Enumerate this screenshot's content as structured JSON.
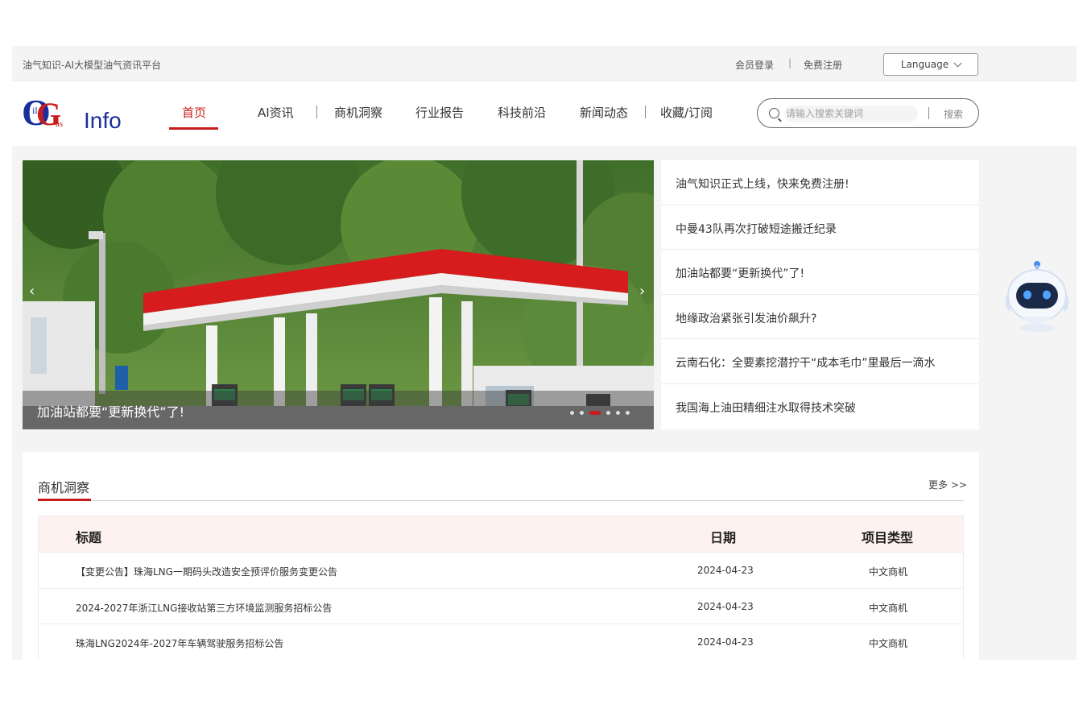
{
  "topbar": {
    "slogan": "油气知识-AI大模型油气资讯平台",
    "login": "会员登录",
    "separator": "|",
    "register": "免费注册",
    "language": "Language"
  },
  "logo": {
    "text_o": "O",
    "text_i": "il",
    "text_g": "G",
    "text_as": "as",
    "text_info": "Info"
  },
  "nav": {
    "items": [
      "首页",
      "AI资讯",
      "商机洞察",
      "行业报告",
      "科技前沿",
      "新闻动态",
      "收藏/订阅"
    ],
    "active": "首页"
  },
  "search": {
    "placeholder": "请输入搜索关键词",
    "button": "搜索"
  },
  "banner": {
    "caption": "加油站都要“更新换代”了!",
    "prev": "‹",
    "next": "›",
    "slide_count": 6,
    "active_slide": 3
  },
  "news": [
    "油气知识正式上线，快来免费注册!",
    "中曼43队再次打破短途搬迁纪录",
    "加油站都要“更新换代”了!",
    "地缘政治紧张引发油价飙升?",
    "云南石化：全要素挖潜拧干“成本毛巾”里最后一滴水",
    "我国海上油田精细注水取得技术突破"
  ],
  "opportunities": {
    "title": "商机洞察",
    "more": "更多 >>",
    "columns": [
      "标题",
      "日期",
      "项目类型"
    ],
    "rows": [
      [
        "【变更公告】珠海LNG一期码头改造安全预评价服务变更公告",
        "2024-04-23",
        "中文商机"
      ],
      [
        "2024-2027年浙江LNG接收站第三方环境监测服务招标公告",
        "2024-04-23",
        "中文商机"
      ],
      [
        "珠海LNG2024年-2027年车辆驾驶服务招标公告",
        "2024-04-23",
        "中文商机"
      ]
    ]
  },
  "colors": {
    "accent": "#c81b1b",
    "logo_blue": "#1a2e9c",
    "logo_red": "#c81b1b"
  }
}
